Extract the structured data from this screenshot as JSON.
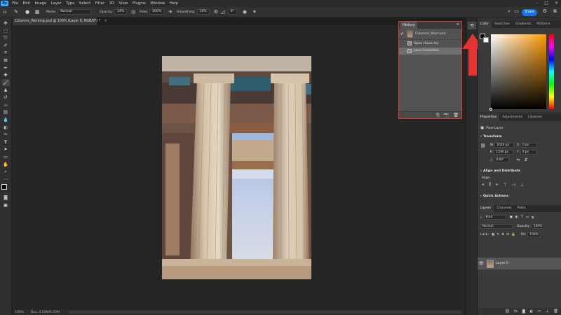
{
  "app": {
    "logo": "Ps",
    "menu": [
      "File",
      "Edit",
      "Image",
      "Layer",
      "Type",
      "Select",
      "Filter",
      "3D",
      "View",
      "Plugins",
      "Window",
      "Help"
    ]
  },
  "options_bar": {
    "mode_label": "Mode:",
    "mode_value": "Normal",
    "opacity_label": "Opacity:",
    "opacity_value": "24%",
    "flow_label": "Flow:",
    "flow_value": "100%",
    "smoothing_label": "Smoothing:",
    "smoothing_value": "10%",
    "angle_value": "0°",
    "share_label": "Share"
  },
  "document": {
    "tab_title": "Columns_Working.psd @ 100% (Layer 0, RGB/8*)",
    "tab_marker": "*",
    "close_glyph": "×"
  },
  "status_bar": {
    "zoom": "100%",
    "doc_info": "Doc: 4.50M/4.50M"
  },
  "history_panel": {
    "tab_label": "History",
    "snapshot_name": "Columns_Start.psd",
    "states": [
      {
        "label": "Open (Save As)"
      },
      {
        "label": "Lens Correction"
      }
    ]
  },
  "color_panel": {
    "tabs": [
      "Color",
      "Swatches",
      "Gradients",
      "Patterns"
    ]
  },
  "properties_panel": {
    "tabs": [
      "Properties",
      "Adjustments",
      "Libraries"
    ],
    "layer_type": "Pixel Layer",
    "transform_label": "Transform",
    "w_label": "W",
    "w_value": "1024 px",
    "x_label": "X",
    "x_value": "0 px",
    "h_label": "H",
    "h_value": "1536 px",
    "y_label": "Y",
    "y_value": "0 px",
    "angle_value": "0.00°",
    "align_label": "Align and Distribute",
    "align_sub": "Align:",
    "quick_actions": "Quick Actions"
  },
  "layers_panel": {
    "tabs": [
      "Layers",
      "Channels",
      "Paths"
    ],
    "kind_label": "Kind",
    "blend_mode": "Normal",
    "opacity_label": "Opacity:",
    "opacity_value": "100%",
    "lock_label": "Lock:",
    "fill_label": "Fill:",
    "fill_value": "100%",
    "layer_name": "Layer 0"
  },
  "colors": {
    "annotation_red": "#e3342f",
    "accent_blue": "#1473e6"
  }
}
